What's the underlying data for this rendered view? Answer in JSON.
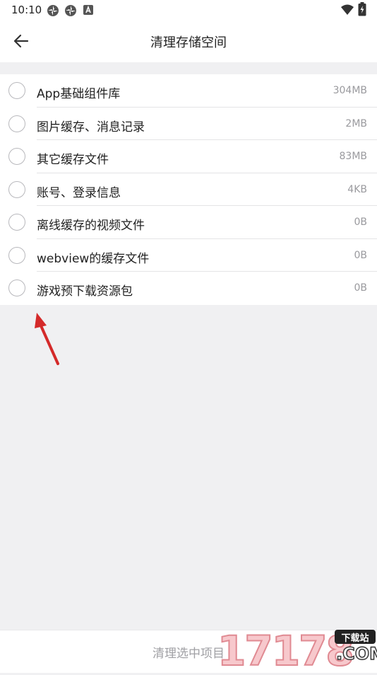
{
  "status_bar": {
    "time": "10:10",
    "icons": [
      "pinwheel-icon",
      "pinwheel-icon",
      "a-box-icon",
      "wifi-icon",
      "battery-charging-icon"
    ]
  },
  "header": {
    "title": "清理存储空间",
    "back_icon": "arrow-left-icon"
  },
  "items": [
    {
      "label": "App基础组件库",
      "size": "304MB"
    },
    {
      "label": "图片缓存、消息记录",
      "size": "2MB"
    },
    {
      "label": "其它缓存文件",
      "size": "83MB"
    },
    {
      "label": "账号、登录信息",
      "size": "4KB"
    },
    {
      "label": "离线缓存的视频文件",
      "size": "0B"
    },
    {
      "label": "webview的缓存文件",
      "size": "0B"
    },
    {
      "label": "游戏预下载资源包",
      "size": "0B"
    }
  ],
  "footer": {
    "clean_label": "清理选中项目"
  },
  "watermark": {
    "digits": "17178",
    "badge": "下载站",
    "com": ".COM"
  },
  "colors": {
    "accent_arrow": "#d42a2a",
    "background": "#f0f0f2",
    "card": "#ffffff"
  }
}
